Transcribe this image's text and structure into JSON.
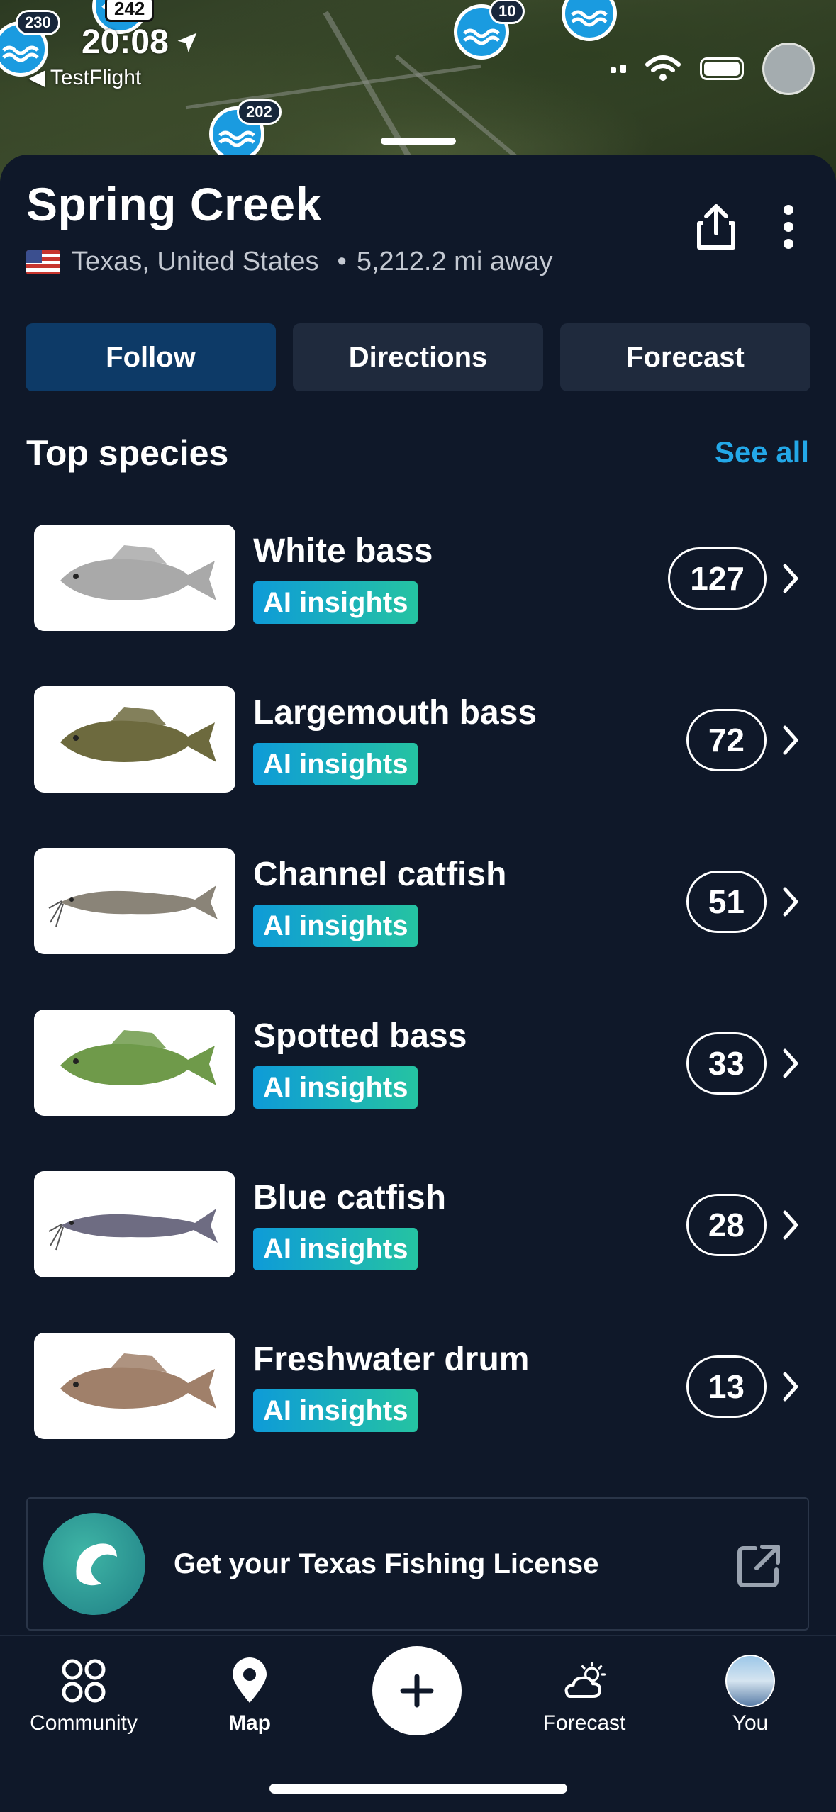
{
  "status_bar": {
    "time": "20:08",
    "back_app": "◀ TestFlight"
  },
  "map": {
    "route_markers": [
      "242"
    ],
    "pin_counts": [
      "230",
      "10",
      "202"
    ]
  },
  "spot": {
    "name": "Spring Creek",
    "region": "Texas, United States",
    "distance": "5,212.2 mi away"
  },
  "actions": {
    "follow": "Follow",
    "directions": "Directions",
    "forecast": "Forecast"
  },
  "species_section": {
    "title": "Top species",
    "see_all": "See all",
    "badge_label": "AI insights",
    "items": [
      {
        "name": "White bass",
        "count": "127",
        "color": "#a9a9a9"
      },
      {
        "name": "Largemouth bass",
        "count": "72",
        "color": "#6d6a3e"
      },
      {
        "name": "Channel catfish",
        "count": "51",
        "color": "#8a8478"
      },
      {
        "name": "Spotted bass",
        "count": "33",
        "color": "#6f9a4a"
      },
      {
        "name": "Blue catfish",
        "count": "28",
        "color": "#6e6c82"
      },
      {
        "name": "Freshwater drum",
        "count": "13",
        "color": "#a0806a"
      }
    ]
  },
  "license": {
    "text": "Get your Texas Fishing License"
  },
  "tabbar": {
    "community": "Community",
    "map": "Map",
    "forecast": "Forecast",
    "you": "You"
  },
  "colors": {
    "background": "#0f1829",
    "primary_button": "#0d3a67",
    "secondary_button": "#1f2a3d",
    "accent_link": "#23a8e8",
    "badge_gradient_start": "#0e9bd8",
    "badge_gradient_end": "#25c3a2"
  }
}
